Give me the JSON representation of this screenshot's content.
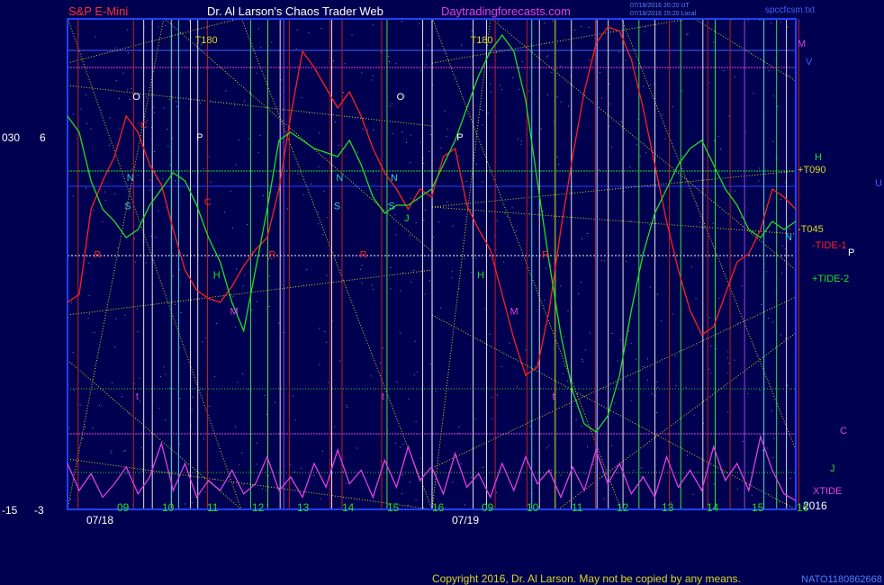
{
  "header": {
    "left": "S&P E-Mini",
    "center": "Dr. Al Larson's Chaos Trader Web",
    "site": "Daytradingforecasts.com",
    "stamp1": "07/18/2016 20:20 UT",
    "stamp2": "07/18/2016 15:20 Local",
    "file": "spccfcsm.txt"
  },
  "footer": {
    "copyright": "Copyright 2016, Dr. Al Larson. May not be copied by any means.",
    "code": "NATO1180862668"
  },
  "colors": {
    "background": "#000050",
    "tide1": "#ff2020",
    "tide2": "#20e020",
    "xtide": "#e040e0",
    "grid_yellow": "#d8d820",
    "axis_blue": "#2040ff"
  },
  "left_scale": {
    "top_a": "030",
    "top_b": "6",
    "bottom_a": "-15",
    "bottom_b": "-3"
  },
  "right_labels": {
    "M": "M",
    "V": "V",
    "H": "H",
    "T090": "+T090",
    "U": "U",
    "T045": "-T045",
    "N": "N",
    "TIDE1": "-TIDE-1",
    "P": "P",
    "TIDE2": "+TIDE-2",
    "C": "C",
    "J": "J",
    "XTIDE": "XTIDE",
    "year": "2016"
  },
  "chart_data": {
    "type": "line",
    "x_ticks": [
      "09",
      "10",
      "11",
      "12",
      "13",
      "14",
      "15",
      "16",
      "09",
      "10",
      "11",
      "12",
      "13",
      "14",
      "15",
      "16"
    ],
    "date_labels": [
      "07/18",
      "07/19"
    ],
    "series": [
      {
        "name": "-TIDE-1",
        "values": [
          0.32,
          0.34,
          0.55,
          0.62,
          0.68,
          0.78,
          0.74,
          0.66,
          0.61,
          0.5,
          0.4,
          0.35,
          0.33,
          0.32,
          0.36,
          0.41,
          0.45,
          0.48,
          0.6,
          0.78,
          0.94,
          0.9,
          0.85,
          0.8,
          0.84,
          0.78,
          0.7,
          0.64,
          0.6,
          0.55,
          0.6,
          0.58,
          0.68,
          0.7,
          0.56,
          0.5,
          0.45,
          0.34,
          0.23,
          0.14,
          0.16,
          0.3,
          0.5,
          0.68,
          0.84,
          0.96,
          1.0,
          0.99,
          0.92,
          0.8,
          0.66,
          0.52,
          0.4,
          0.3,
          0.24,
          0.26,
          0.34,
          0.42,
          0.44,
          0.5,
          0.6,
          0.58,
          0.55
        ]
      },
      {
        "name": "+TIDE-2",
        "values": [
          0.78,
          0.74,
          0.62,
          0.55,
          0.52,
          0.48,
          0.5,
          0.56,
          0.6,
          0.64,
          0.62,
          0.56,
          0.48,
          0.42,
          0.32,
          0.25,
          0.4,
          0.55,
          0.72,
          0.74,
          0.72,
          0.7,
          0.69,
          0.68,
          0.72,
          0.66,
          0.58,
          0.54,
          0.56,
          0.56,
          0.58,
          0.6,
          0.66,
          0.72,
          0.8,
          0.88,
          0.94,
          0.98,
          0.94,
          0.82,
          0.62,
          0.42,
          0.24,
          0.1,
          0.02,
          0.0,
          0.04,
          0.14,
          0.3,
          0.44,
          0.54,
          0.6,
          0.66,
          0.7,
          0.72,
          0.66,
          0.6,
          0.56,
          0.5,
          0.48,
          0.52,
          0.5,
          0.52
        ]
      },
      {
        "name": "XTIDE",
        "values": [
          0.6,
          0.2,
          0.45,
          0.1,
          0.3,
          0.55,
          0.15,
          0.4,
          0.9,
          0.2,
          0.6,
          0.1,
          0.35,
          0.2,
          0.5,
          0.15,
          0.3,
          0.7,
          0.2,
          0.4,
          0.1,
          0.6,
          0.25,
          0.8,
          0.3,
          0.5,
          0.1,
          0.65,
          0.25,
          0.85,
          0.35,
          0.55,
          0.15,
          0.75,
          0.25,
          0.45,
          0.1,
          0.6,
          0.2,
          0.7,
          0.3,
          0.5,
          0.1,
          0.55,
          0.2,
          0.8,
          0.3,
          0.6,
          0.15,
          0.4,
          0.1,
          0.7,
          0.25,
          0.5,
          0.2,
          0.85,
          0.35,
          0.6,
          0.2,
          1.0,
          0.5,
          0.15,
          0.05
        ]
      }
    ],
    "ylim": [
      0,
      1
    ],
    "red_lines": [
      0.08,
      0.5,
      0.79,
      1.06,
      1.68,
      1.99,
      2.08,
      2.38,
      3.24,
      3.48,
      3.69,
      4.0,
      4.56,
      4.85,
      5.02,
      5.54
    ],
    "white_lines": [
      0.62,
      0.69,
      1.0,
      1.06,
      1.73,
      2.15,
      2.89,
      3.3,
      3.41,
      3.84,
      4.1,
      4.4,
      4.52,
      4.78,
      5.17,
      5.85
    ],
    "green_lines": [
      1.49,
      1.63,
      2.6,
      3.97,
      4.65,
      4.99,
      5.27,
      5.77
    ],
    "cyan_lines": [
      1.14,
      1.22,
      5.1,
      5.82,
      7.65
    ],
    "violet_lines": [
      1.9,
      4.65,
      5.95
    ],
    "letter_labels": [
      {
        "text": "O",
        "color": "#ffffff",
        "x": 1.43,
        "v": 0.82
      },
      {
        "text": "P",
        "color": "#ffffff",
        "x": 2.83,
        "v": 0.72
      },
      {
        "text": "N",
        "color": "#30d0d0",
        "x": 1.3,
        "v": 0.62
      },
      {
        "text": "S",
        "color": "#30d0d0",
        "x": 1.25,
        "v": 0.55
      },
      {
        "text": "C",
        "color": "#ff2020",
        "x": 1.6,
        "v": 0.75
      },
      {
        "text": "C",
        "color": "#ff2020",
        "x": 3.0,
        "v": 0.56
      },
      {
        "text": "R",
        "color": "#ff2020",
        "x": 0.58,
        "v": 0.43
      },
      {
        "text": "R",
        "color": "#ff2020",
        "x": 4.42,
        "v": 0.43
      },
      {
        "text": "R",
        "color": "#ff2020",
        "x": 6.42,
        "v": 0.43
      },
      {
        "text": "R",
        "color": "#ff2020",
        "x": 10.42,
        "v": 0.43
      },
      {
        "text": "H",
        "color": "#20e020",
        "x": 3.2,
        "v": 0.38
      },
      {
        "text": "H",
        "color": "#20e020",
        "x": 9.0,
        "v": 0.38
      },
      {
        "text": "M",
        "color": "#e040e0",
        "x": 3.57,
        "v": 0.29
      },
      {
        "text": "M",
        "color": "#e040e0",
        "x": 9.72,
        "v": 0.29
      },
      {
        "text": "T180",
        "color": "#d8d820",
        "x": 2.8,
        "v": 0.96
      },
      {
        "text": "T180",
        "color": "#d8d820",
        "x": 8.85,
        "v": 0.96
      },
      {
        "text": "O",
        "color": "#ffffff",
        "x": 7.23,
        "v": 0.82
      },
      {
        "text": "P",
        "color": "#ffffff",
        "x": 8.55,
        "v": 0.72
      },
      {
        "text": "N",
        "color": "#30d0d0",
        "x": 7.1,
        "v": 0.62
      },
      {
        "text": "S",
        "color": "#30d0d0",
        "x": 7.05,
        "v": 0.55
      },
      {
        "text": "N",
        "color": "#30d0d0",
        "x": 5.9,
        "v": 0.62
      },
      {
        "text": "S",
        "color": "#30d0d0",
        "x": 5.85,
        "v": 0.55
      },
      {
        "text": "J",
        "color": "#20e020",
        "x": 7.4,
        "v": 0.52
      },
      {
        "text": "t",
        "color": "#e040e0",
        "x": 1.5,
        "v": 0.08
      },
      {
        "text": "t",
        "color": "#e040e0",
        "x": 6.9,
        "v": 0.08
      },
      {
        "text": "t",
        "color": "#e040e0",
        "x": 10.65,
        "v": 0.08
      }
    ]
  }
}
